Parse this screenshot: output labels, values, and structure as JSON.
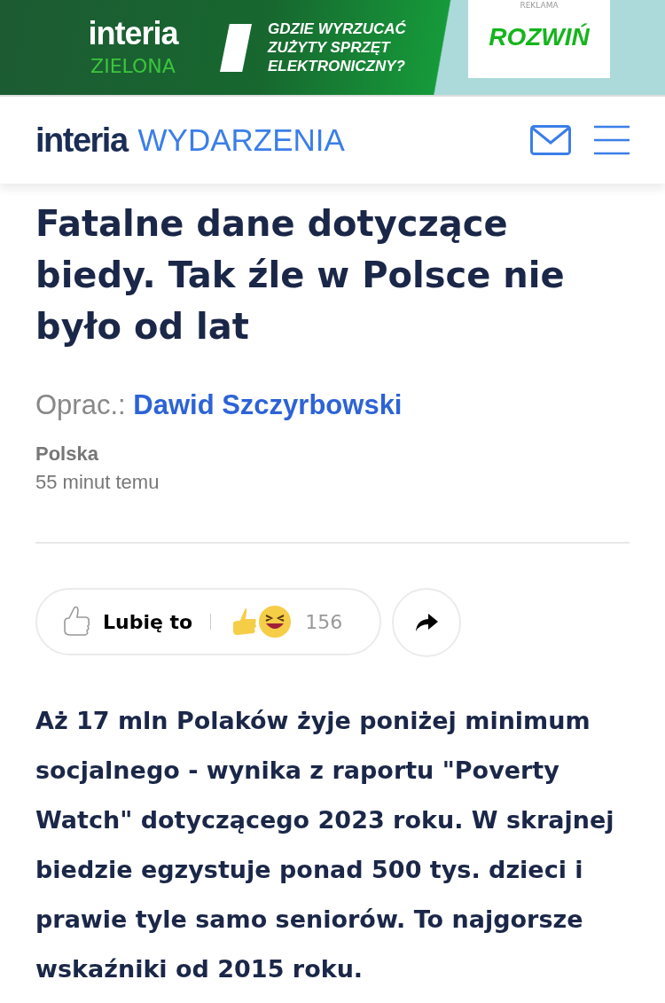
{
  "ad_banner": {
    "brand": "interia",
    "brand_sub": "ZIELONA",
    "headline": "GDZIE WYRZUCAĆ ZUŻYTY SPRZĘT ELEKTRONICZNY?",
    "label": "REKLAMA",
    "button": "ROZWIŃ"
  },
  "header": {
    "logo": "interia",
    "section": "WYDARZENIA"
  },
  "article": {
    "title": "Fatalne dane dotyczące biedy. Tak źle w Polsce nie było od lat",
    "byline_label": "Oprac.:",
    "author": "Dawid Szczyrbowski",
    "category": "Polska",
    "time": "55 minut temu",
    "reactions": {
      "like_label": "Lubię to",
      "count": "156"
    },
    "lead": "Aż 17 mln Polaków żyje poniżej minimum socjalnego - wynika z raportu \"Poverty Watch\" dotyczącego 2023 roku. W skrajnej biedzie egzystuje ponad 500 tys. dzieci i prawie tyle samo seniorów. To najgorsze wskaźniki od 2015 roku."
  }
}
